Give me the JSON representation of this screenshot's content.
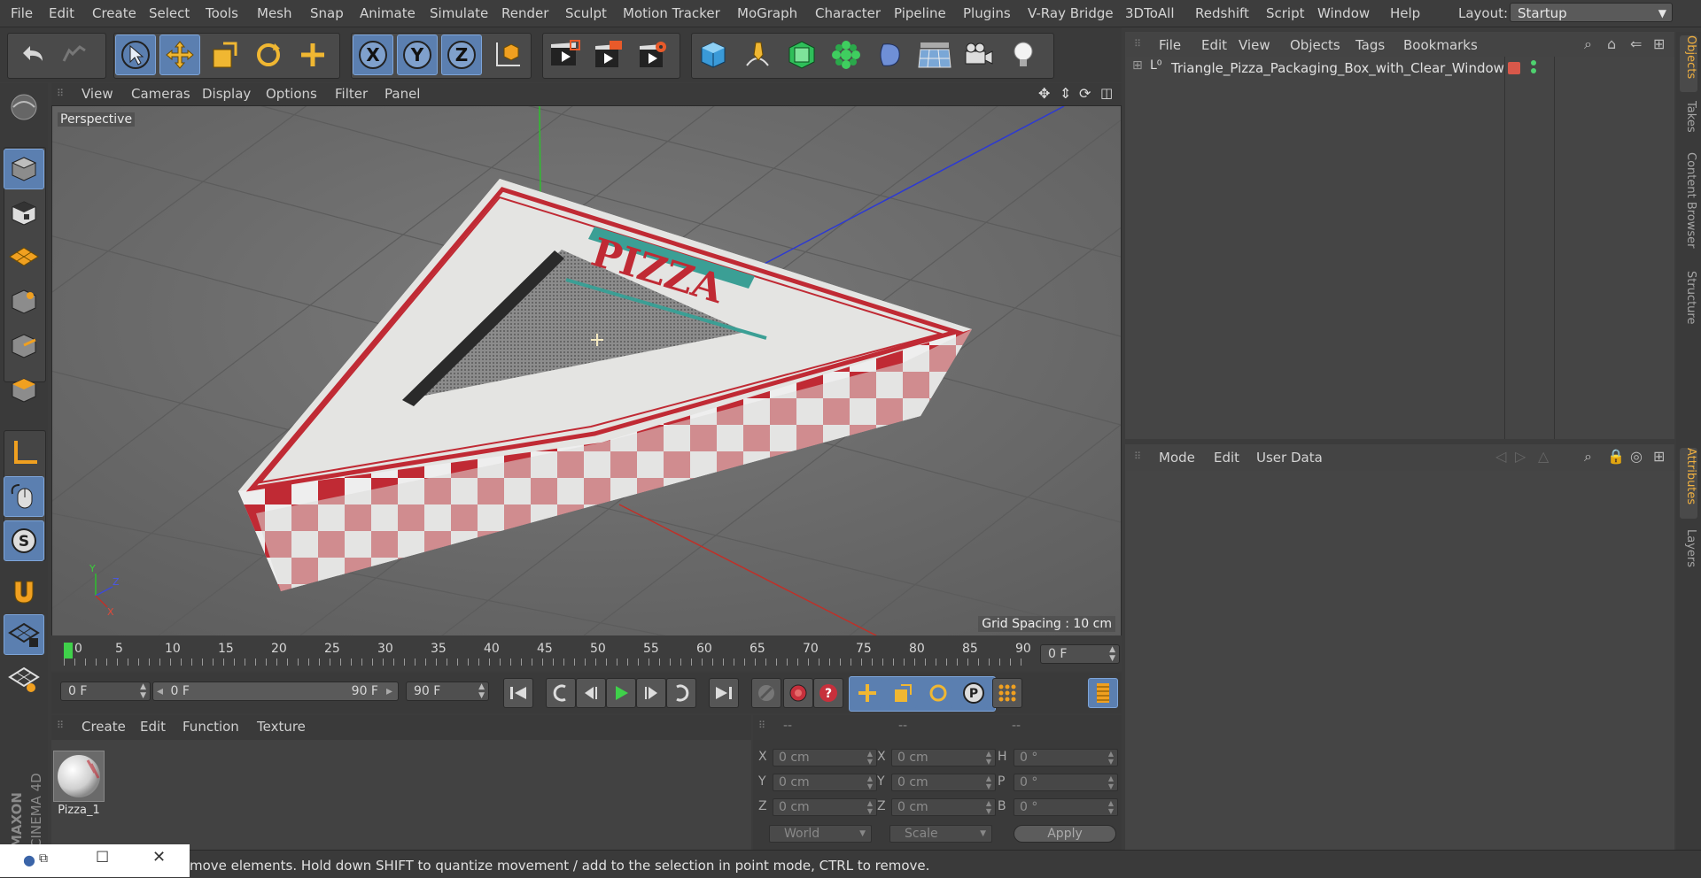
{
  "menu": [
    "File",
    "Edit",
    "Create",
    "Select",
    "Tools",
    "Mesh",
    "Snap",
    "Animate",
    "Simulate",
    "Render",
    "Sculpt",
    "Motion Tracker",
    "MoGraph",
    "Character",
    "Pipeline",
    "Plugins",
    "V-Ray Bridge",
    "3DToAll",
    "Redshift",
    "Script",
    "Window",
    "Help"
  ],
  "layout": {
    "label": "Layout:",
    "value": "Startup"
  },
  "toolbar_icons": [
    "undo-icon",
    "redo-icon",
    "select-arrow-icon",
    "move-icon",
    "scale-icon",
    "rotate-icon",
    "add-icon",
    "x-axis-icon",
    "y-axis-icon",
    "z-axis-icon",
    "world-coords-icon",
    "render-view-icon",
    "render-active-icon",
    "render-settings-icon",
    "cube-icon",
    "pen-icon",
    "subdivision-icon",
    "cloner-icon",
    "deformer-icon",
    "floor-icon",
    "camera-icon",
    "light-icon"
  ],
  "viewport": {
    "menu": [
      "View",
      "Cameras",
      "Display",
      "Options",
      "Filter",
      "Panel"
    ],
    "label": "Perspective",
    "grid_spacing": "Grid Spacing : 10 cm",
    "box_text": "PIZZA"
  },
  "timeline": {
    "ticks": [
      "0",
      "5",
      "10",
      "15",
      "20",
      "25",
      "30",
      "35",
      "40",
      "45",
      "50",
      "55",
      "60",
      "65",
      "70",
      "75",
      "80",
      "85",
      "90"
    ],
    "current_frame": "0 F",
    "start": "0 F",
    "range_start": "0 F",
    "range_end": "90 F",
    "end": "90 F"
  },
  "materials": {
    "menu": [
      "Create",
      "Edit",
      "Function",
      "Texture"
    ],
    "items": [
      {
        "name": "Pizza_1"
      }
    ]
  },
  "coords": {
    "headers": [
      "--",
      "--",
      "--"
    ],
    "rows": [
      {
        "a": "X",
        "av": "0 cm",
        "b": "X",
        "bv": "0 cm",
        "c": "H",
        "cv": "0 °"
      },
      {
        "a": "Y",
        "av": "0 cm",
        "b": "Y",
        "bv": "0 cm",
        "c": "P",
        "cv": "0 °"
      },
      {
        "a": "Z",
        "av": "0 cm",
        "b": "Z",
        "bv": "0 cm",
        "c": "B",
        "cv": "0 °"
      }
    ],
    "mode1": "World",
    "mode2": "Scale",
    "apply": "Apply"
  },
  "objects": {
    "menu": [
      "File",
      "Edit",
      "View",
      "Objects",
      "Tags",
      "Bookmarks"
    ],
    "tree": [
      {
        "name": "Triangle_Pizza_Packaging_Box_with_Clear_Window",
        "tag_color": "#d8584a",
        "dot_color": "#4fd16f"
      }
    ]
  },
  "attributes": {
    "menu": [
      "Mode",
      "Edit",
      "User Data"
    ]
  },
  "side_tabs": [
    "Objects",
    "Takes",
    "Content Browser",
    "Structure",
    "Attributes",
    "Layers"
  ],
  "brand": "MAXON CINEMA 4D",
  "status": "move elements. Hold down SHIFT to quantize movement / add to the selection in point mode, CTRL to remove.",
  "colors": {
    "accent": "#5b7fb0",
    "play": "#3fd14a",
    "red": "#c7303c"
  }
}
